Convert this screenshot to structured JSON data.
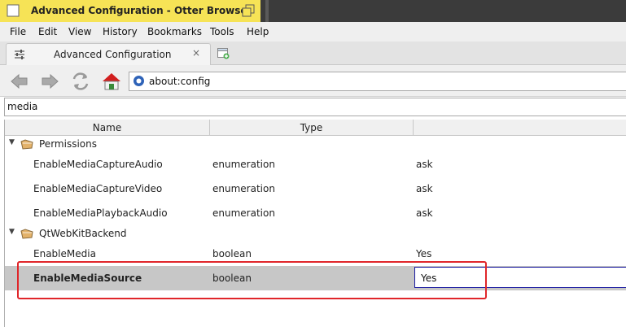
{
  "window": {
    "title": "Advanced Configuration - Otter Browser"
  },
  "menu": {
    "items": [
      "File",
      "Edit",
      "View",
      "History",
      "Bookmarks",
      "Tools",
      "Help"
    ]
  },
  "tab": {
    "label": "Advanced Configuration",
    "close": "×"
  },
  "address": {
    "url": "about:config"
  },
  "filter": {
    "value": "media"
  },
  "table": {
    "headers": [
      "Name",
      "Type",
      ""
    ],
    "groups": [
      {
        "label": "Permissions",
        "rows": [
          {
            "name": "EnableMediaCaptureAudio",
            "type": "enumeration",
            "value": "ask"
          },
          {
            "name": "EnableMediaCaptureVideo",
            "type": "enumeration",
            "value": "ask"
          },
          {
            "name": "EnableMediaPlaybackAudio",
            "type": "enumeration",
            "value": "ask"
          }
        ]
      },
      {
        "label": "QtWebKitBackend",
        "rows": [
          {
            "name": "EnableMedia",
            "type": "boolean",
            "value": "Yes"
          },
          {
            "name": "EnableMediaSource",
            "type": "boolean",
            "value": "Yes"
          }
        ]
      }
    ]
  },
  "colors": {
    "titlebar": "#f6e356",
    "selection": "#c7c7c7",
    "highlight": "#e0262a",
    "editor_border": "#1a1aa0"
  }
}
